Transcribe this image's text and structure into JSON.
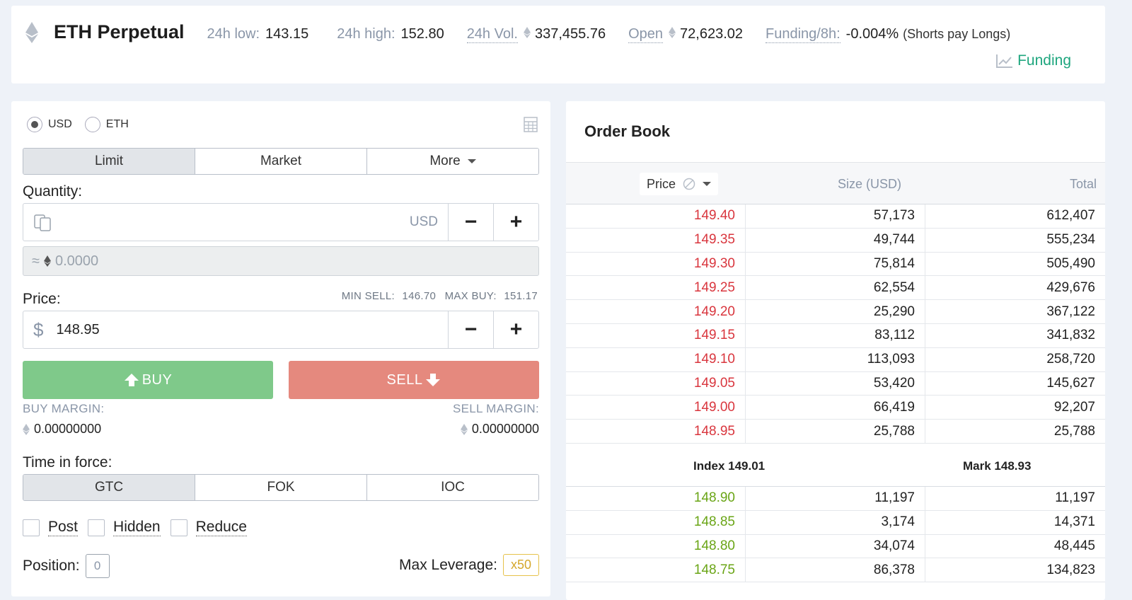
{
  "market": {
    "title": "ETH Perpetual",
    "low_label": "24h low:",
    "low_value": "143.15",
    "high_label": "24h high:",
    "high_value": "152.80",
    "vol_label": "24h Vol.",
    "vol_value": "337,455.76",
    "open_label": "Open",
    "open_value": "72,623.02",
    "funding_label": "Funding/8h:",
    "funding_value": "-0.004%",
    "funding_note": "(Shorts pay Longs)",
    "funding_link": "Funding"
  },
  "order": {
    "currency_usd": "USD",
    "currency_eth": "ETH",
    "types": [
      "Limit",
      "Market",
      "More"
    ],
    "quantity_label": "Quantity:",
    "quantity_unit": "USD",
    "minus": "−",
    "plus": "+",
    "approx_symbol": "≈",
    "approx_value": "0.0000",
    "price_label": "Price:",
    "min_sell_label": "MIN SELL:",
    "min_sell_value": "146.70",
    "max_buy_label": "MAX BUY:",
    "max_buy_value": "151.17",
    "price_symbol": "$",
    "price_value": "148.95",
    "buy_label": "BUY",
    "sell_label": "SELL",
    "buy_margin_label": "BUY MARGIN:",
    "buy_margin_value": "0.00000000",
    "sell_margin_label": "SELL MARGIN:",
    "sell_margin_value": "0.00000000",
    "tif_label": "Time in force:",
    "tif_options": [
      "GTC",
      "FOK",
      "IOC"
    ],
    "post_label": "Post",
    "hidden_label": "Hidden",
    "reduce_label": "Reduce",
    "position_label": "Position:",
    "position_value": "0",
    "leverage_label": "Max Leverage:",
    "leverage_value": "x50"
  },
  "book": {
    "title": "Order Book",
    "col_price": "Price",
    "col_size": "Size (USD)",
    "col_total": "Total",
    "asks": [
      [
        "149.40",
        "57,173",
        "612,407"
      ],
      [
        "149.35",
        "49,744",
        "555,234"
      ],
      [
        "149.30",
        "75,814",
        "505,490"
      ],
      [
        "149.25",
        "62,554",
        "429,676"
      ],
      [
        "149.20",
        "25,290",
        "367,122"
      ],
      [
        "149.15",
        "83,112",
        "341,832"
      ],
      [
        "149.10",
        "113,093",
        "258,720"
      ],
      [
        "149.05",
        "53,420",
        "145,627"
      ],
      [
        "149.00",
        "66,419",
        "92,207"
      ],
      [
        "148.95",
        "25,788",
        "25,788"
      ]
    ],
    "index_text": "Index 149.01",
    "mark_text": "Mark  148.93",
    "bids": [
      [
        "148.90",
        "11,197",
        "11,197"
      ],
      [
        "148.85",
        "3,174",
        "14,371"
      ],
      [
        "148.80",
        "34,074",
        "48,445"
      ],
      [
        "148.75",
        "86,378",
        "134,823"
      ]
    ]
  },
  "colors": {
    "ask": "#d9363e",
    "bid": "#6aa516",
    "buy": "#7fc98a",
    "sell": "#e5897e",
    "accent": "#1ea67e"
  }
}
